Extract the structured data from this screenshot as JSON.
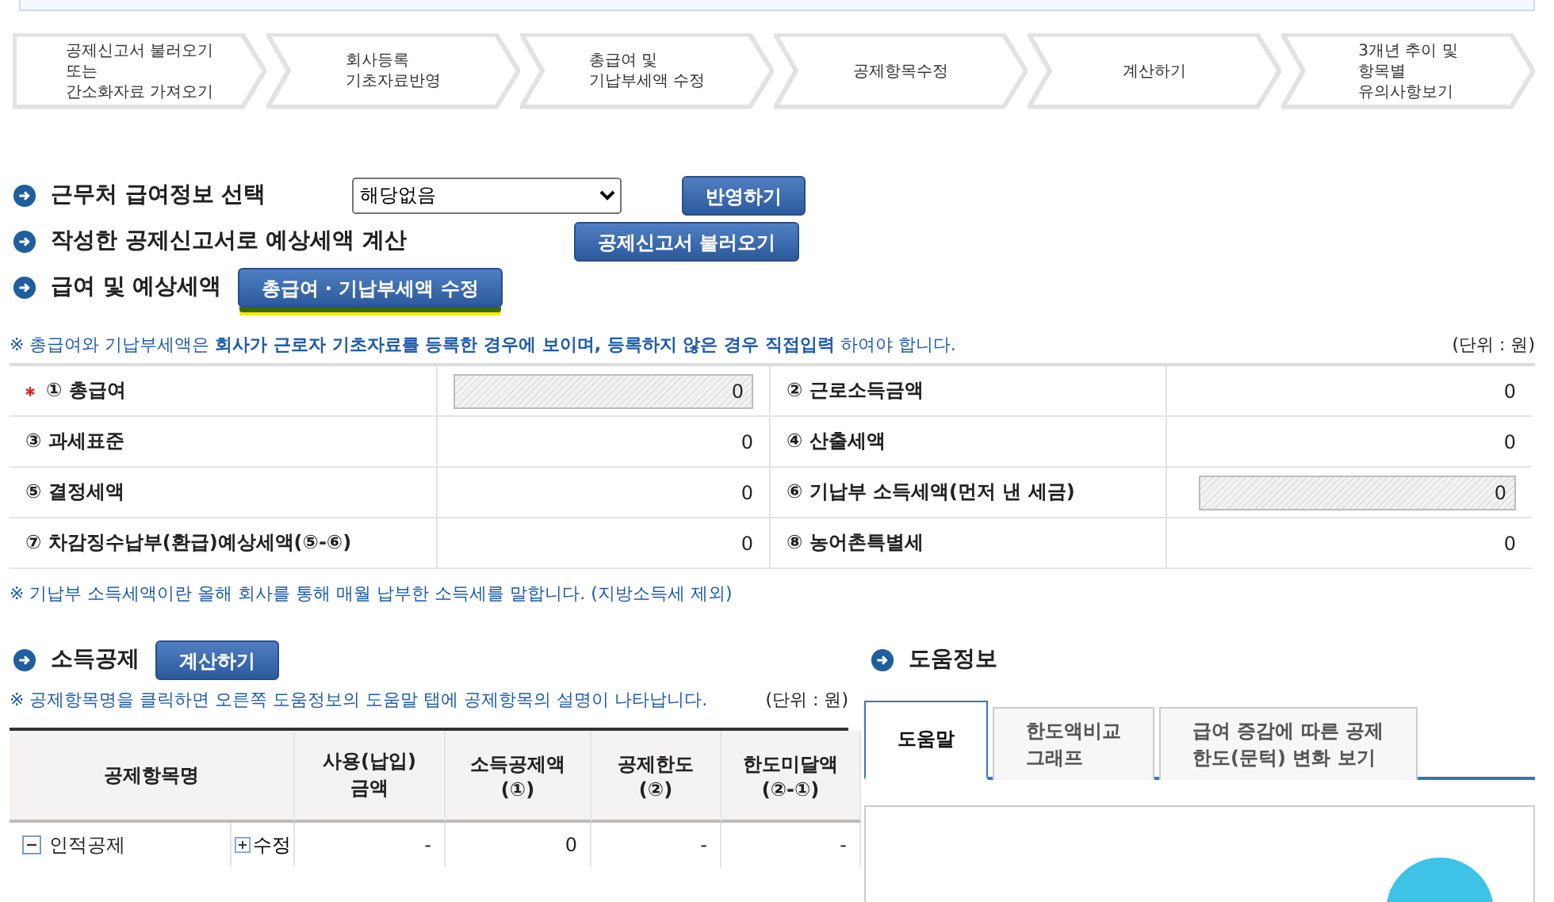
{
  "steps": [
    {
      "label": "공제신고서 불러오기\n또는\n간소화자료 가져오기"
    },
    {
      "label": "회사등록\n기초자료반영"
    },
    {
      "label": "총급여 및\n기납부세액 수정"
    },
    {
      "label": "공제항목수정"
    },
    {
      "label": "계산하기"
    },
    {
      "label": "3개년 추이 및\n항목별\n유의사항보기"
    }
  ],
  "sections": [
    {
      "title": "근무처 급여정보 선택",
      "select": {
        "value": "해당없음"
      },
      "button": {
        "label": "반영하기",
        "highlighted": false
      }
    },
    {
      "title": "작성한 공제신고서로 예상세액 계산",
      "button": {
        "label": "공제신고서 불러오기",
        "highlighted": false
      }
    },
    {
      "title": "급여 및 예상세액",
      "button": {
        "label": "총급여 · 기납부세액 수정",
        "highlighted": true
      }
    }
  ],
  "salary_note": "※ 총급여와 기납부세액은 **회사가 근로자 기초자료를 등록한 경우에 보이며, 등록하지 않은 경우 직접입력** 하여야 합니다.",
  "salary_unit": "(단위 : 원)",
  "salary_rows": [
    [
      {
        "label": "① 총급여",
        "required": true,
        "kind": "input",
        "value": "0"
      },
      {
        "label": "② 근로소득금액",
        "required": false,
        "kind": "text",
        "value": "0"
      }
    ],
    [
      {
        "label": "③ 과세표준",
        "required": false,
        "kind": "text",
        "value": "0"
      },
      {
        "label": "④ 산출세액",
        "required": false,
        "kind": "text",
        "value": "0"
      }
    ],
    [
      {
        "label": "⑤ 결정세액",
        "required": false,
        "kind": "text",
        "value": "0"
      },
      {
        "label": "⑥ 기납부 소득세액(먼저 낸 세금)",
        "required": false,
        "kind": "input",
        "value": "0"
      }
    ],
    [
      {
        "label": "⑦ 차감징수납부(환급)예상세액(⑤-⑥)",
        "required": false,
        "kind": "text",
        "value": "0"
      },
      {
        "label": "⑧ 농어촌특별세",
        "required": false,
        "kind": "text",
        "value": "0"
      }
    ]
  ],
  "salary_footnote": "※ 기납부 소득세액이란 올해 회사를 통해 매월 납부한 소득세를 말합니다. (지방소득세 제외)",
  "deduction": {
    "title": "소득공제",
    "button": "계산하기",
    "note": "※ 공제항목명을 클릭하면 오른쪽 도움정보의 도움말 탭에 공제항목의 설명이 나타납니다.",
    "unit": "(단위 : 원)",
    "columns": [
      "공제항목명",
      "사용(납입)\n금액",
      "소득공제액\n(①)",
      "공제한도\n(②)",
      "한도미달액\n(②-①)"
    ],
    "rows": [
      {
        "name": "인적공제",
        "expanded": true,
        "edit": "수정",
        "values": [
          "-",
          "0",
          "-",
          "-"
        ]
      }
    ]
  },
  "help": {
    "title": "도움정보",
    "tabs": [
      {
        "label": "도움말",
        "selected": true
      },
      {
        "label": "한도액비교\n그래프",
        "selected": false
      },
      {
        "label": "급여 증감에 따른 공제\n한도(문턱) 변화 보기",
        "selected": false
      }
    ]
  }
}
